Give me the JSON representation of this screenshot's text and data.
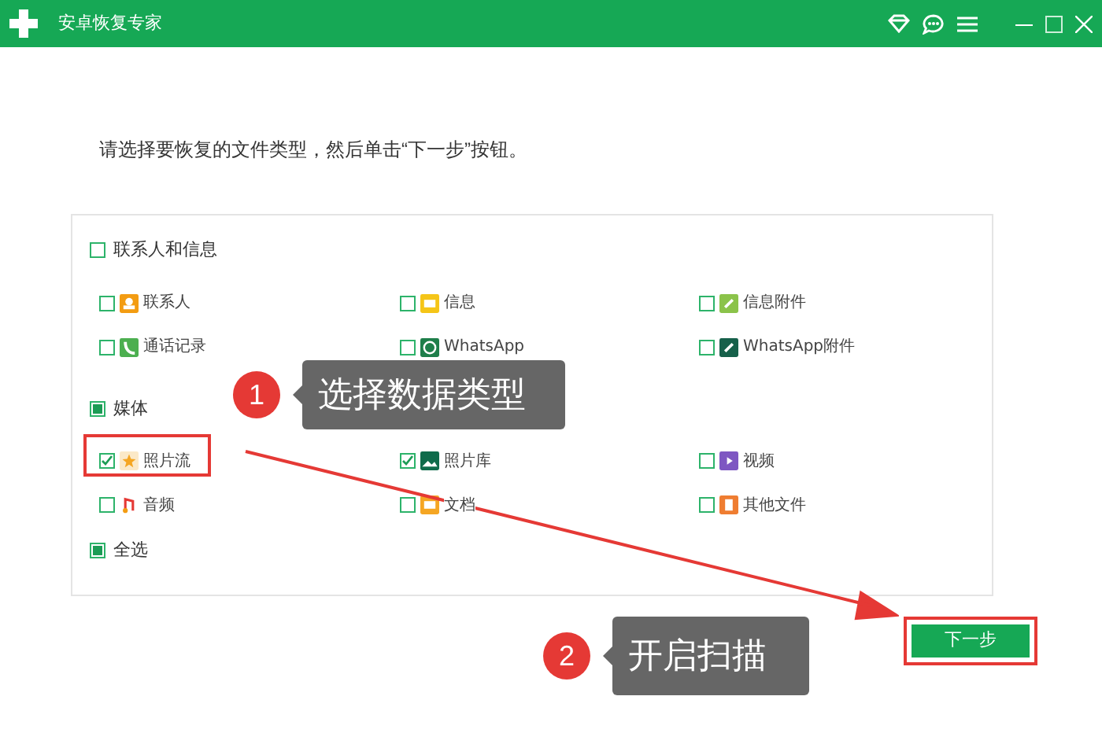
{
  "window": {
    "title": "安卓恢复专家"
  },
  "instruction": "请选择要恢复的文件类型，然后单击“下一步”按钮。",
  "groups": [
    {
      "label": "联系人和信息",
      "checked": false,
      "partial": false,
      "items": [
        {
          "label": "联系人",
          "checked": false
        },
        {
          "label": "信息",
          "checked": false
        },
        {
          "label": "信息附件",
          "checked": false
        },
        {
          "label": "通话记录",
          "checked": false
        },
        {
          "label": "WhatsApp",
          "checked": false
        },
        {
          "label": "WhatsApp附件",
          "checked": false
        }
      ]
    },
    {
      "label": "媒体",
      "checked": false,
      "partial": true,
      "items": [
        {
          "label": "照片流",
          "checked": true
        },
        {
          "label": "照片库",
          "checked": true
        },
        {
          "label": "视频",
          "checked": false
        },
        {
          "label": "音频",
          "checked": false
        },
        {
          "label": "文档",
          "checked": false
        },
        {
          "label": "其他文件",
          "checked": false
        }
      ]
    }
  ],
  "select_all": {
    "label": "全选",
    "checked": false,
    "partial": true
  },
  "next_button": "下一步",
  "callouts": [
    {
      "number": "1",
      "text": "选择数据类型"
    },
    {
      "number": "2",
      "text": "开启扫描"
    }
  ]
}
